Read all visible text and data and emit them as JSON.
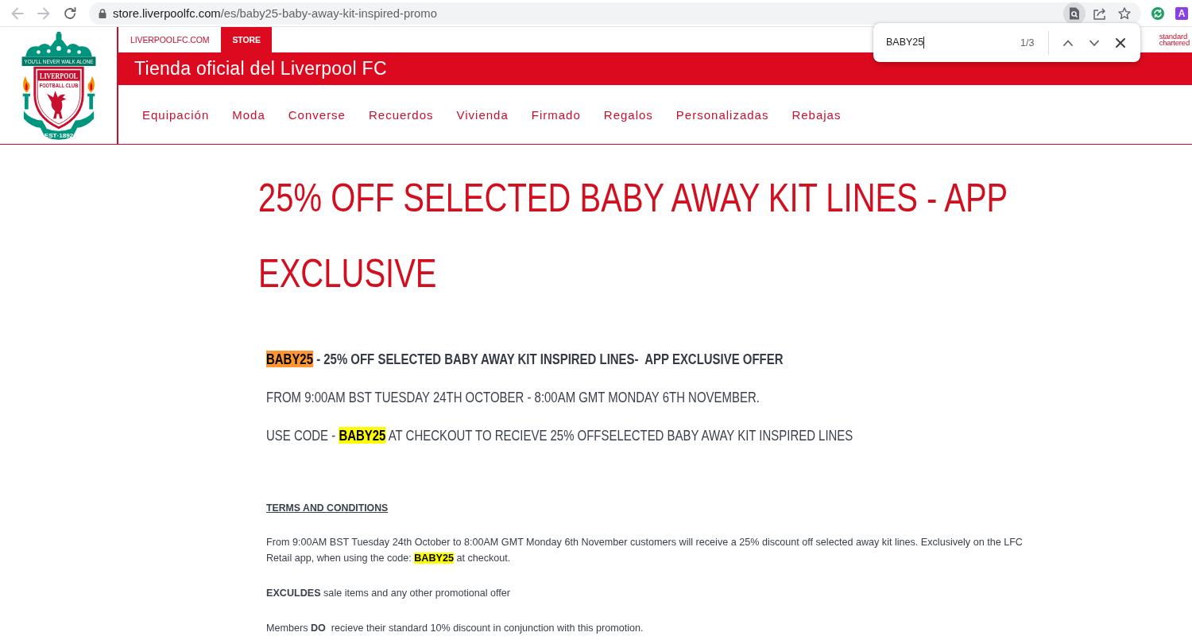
{
  "browser": {
    "back_disabled": true,
    "forward_disabled": true,
    "url_host": "store.liverpoolfc.com",
    "url_path": "/es/baby25-baby-away-kit-inspired-promo",
    "find_button_pressed": true,
    "extension_label": "A"
  },
  "find_bar": {
    "query": "BABY25",
    "count": "1/3"
  },
  "header": {
    "crest": {
      "motto": "YOU'LL NEVER WALK ALONE",
      "name": "LIVERPOOL",
      "subtitle": "FOOTBALL CLUB",
      "founded": "EST·1892"
    },
    "top_links": [
      {
        "label": "LIVERPOOLFC.COM",
        "selected": false
      },
      {
        "label": "STORE",
        "selected": true
      }
    ],
    "sponsor": [
      "standard",
      "chartered"
    ],
    "banner_title": "Tienda oficial del Liverpool FC",
    "menu": [
      "Equipación",
      "Moda",
      "Converse",
      "Recuerdos",
      "Vivienda",
      "Firmado",
      "Regalos",
      "Personalizadas",
      "Rebajas"
    ]
  },
  "promo": {
    "title": "25% OFF SELECTED BABY AWAY KIT LINES - APP EXCLUSIVE",
    "paragraphs": [
      {
        "kind": "lead",
        "parts": [
          {
            "text": "BABY25",
            "highlighted": true,
            "selected": true
          },
          {
            "text": " - 25% OFF SELECTED BABY AWAY KIT INSPIRED LINES-  APP EXCLUSIVE OFFER",
            "highlighted": false,
            "selected": false
          }
        ]
      },
      {
        "kind": "plain",
        "parts": [
          {
            "text": "FROM 9:00AM BST TUESDAY 24TH OCTOBER - 8:00AM GMT MONDAY 6TH NOVEMBER.",
            "highlighted": false,
            "selected": false
          }
        ]
      },
      {
        "kind": "plain",
        "parts": [
          {
            "text": "USE CODE - ",
            "highlighted": false,
            "selected": false
          },
          {
            "text": "**BABY25**",
            "highlighted": true,
            "selected": false
          },
          {
            "text": " AT CHECKOUT TO RECIEVE 25% OFFSELECTED BABY AWAY KIT INSPIRED LINES",
            "highlighted": false,
            "selected": false
          }
        ]
      },
      {
        "kind": "terms_heading",
        "parts": [
          {
            "text": "TERMS AND CONDITIONS",
            "highlighted": false,
            "selected": false
          }
        ]
      },
      {
        "kind": "terms",
        "parts": [
          {
            "text": "From 9:00AM BST Tuesday 24th October to 8:00AM GMT Monday 6th November customers will receive a 25% discount off selected away kit lines. Exclusively on the LFC Retail app, when using the code: ",
            "highlighted": false,
            "selected": false
          },
          {
            "text": "**BABY25**",
            "highlighted": true,
            "selected": false
          },
          {
            "text": " at checkout.",
            "highlighted": false,
            "selected": false
          }
        ]
      },
      {
        "kind": "terms",
        "parts": [
          {
            "text": "**EXCULDES** sale items and any other promotional offer",
            "highlighted": false,
            "selected": false
          }
        ]
      },
      {
        "kind": "terms",
        "parts": [
          {
            "text": "Members **DO**  recieve their standard 10% discount in conjunction with this promotion.",
            "highlighted": false,
            "selected": false
          }
        ]
      }
    ]
  }
}
